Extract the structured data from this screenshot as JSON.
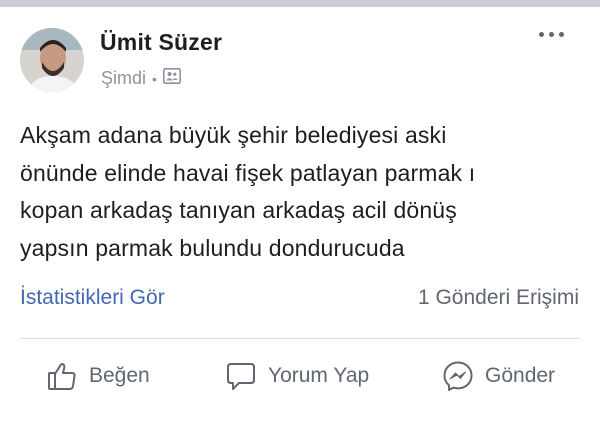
{
  "post": {
    "author_name": "Ümit Süzer",
    "timestamp": "Şimdi",
    "separator": "•",
    "audience_icon": "friends-audience-icon",
    "more_icon": "more-options-icon",
    "text_lines": [
      "Akşam adana büyük şehir belediyesi aski",
      "önünde elinde havai fişek patlayan parmak ı",
      "kopan arkadaş tanıyan arkadaş acil dönüş",
      "yapsın parmak bulundu dondurucuda"
    ]
  },
  "insights": {
    "link_label": "İstatistikleri Gör",
    "reach_label": "1 Gönderi Erişimi"
  },
  "actions": {
    "like": {
      "label": "Beğen",
      "icon": "thumbs-up-icon"
    },
    "comment": {
      "label": "Yorum Yap",
      "icon": "comment-bubble-icon"
    },
    "send": {
      "label": "Gönder",
      "icon": "messenger-icon"
    }
  },
  "colors": {
    "link": "#4267b2",
    "secondary_text": "#606770",
    "meta_text": "#8d949e",
    "primary_text": "#1c1e21",
    "divider": "#dadde1"
  }
}
